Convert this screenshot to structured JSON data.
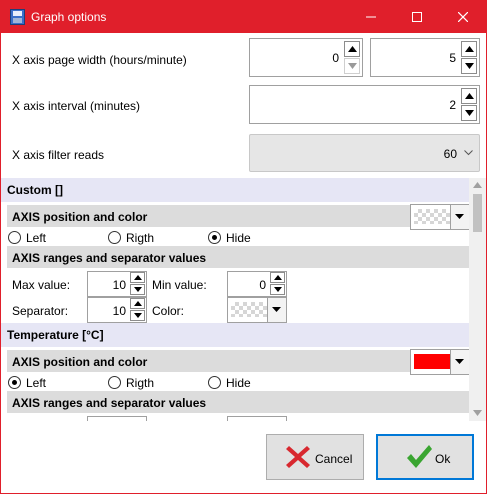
{
  "window": {
    "title": "Graph options",
    "accent": "#e01f2b"
  },
  "top": {
    "page_width": {
      "label": "X axis page width (hours/minute)",
      "hours": "0",
      "minutes": "5"
    },
    "interval": {
      "label": "X axis interval (minutes)",
      "value": "2"
    },
    "filter": {
      "label": "X axis filter reads",
      "value": "60"
    }
  },
  "sections": [
    {
      "title": "Custom []",
      "axis_head": "AXIS position and color",
      "positions": [
        "Left",
        "Rigth",
        "Hide"
      ],
      "selected": "Hide",
      "axis_color": "transparent",
      "ranges_head": "AXIS ranges and separator values",
      "max_label": "Max value:",
      "max_value": "10",
      "min_label": "Min value:",
      "min_value": "0",
      "sep_label": "Separator:",
      "sep_value": "10",
      "color_label": "Color:"
    },
    {
      "title": "Temperature [°C]",
      "axis_head": "AXIS position and color",
      "positions": [
        "Left",
        "Rigth",
        "Hide"
      ],
      "selected": "Left",
      "axis_color": "#ff0000",
      "ranges_head": "AXIS ranges and separator values"
    }
  ],
  "buttons": {
    "cancel": "Cancel",
    "ok": "Ok"
  },
  "colors": {
    "cancel_x": "#d8282f",
    "ok_check": "#3aa531",
    "panel_head": "#e6e6f5"
  }
}
